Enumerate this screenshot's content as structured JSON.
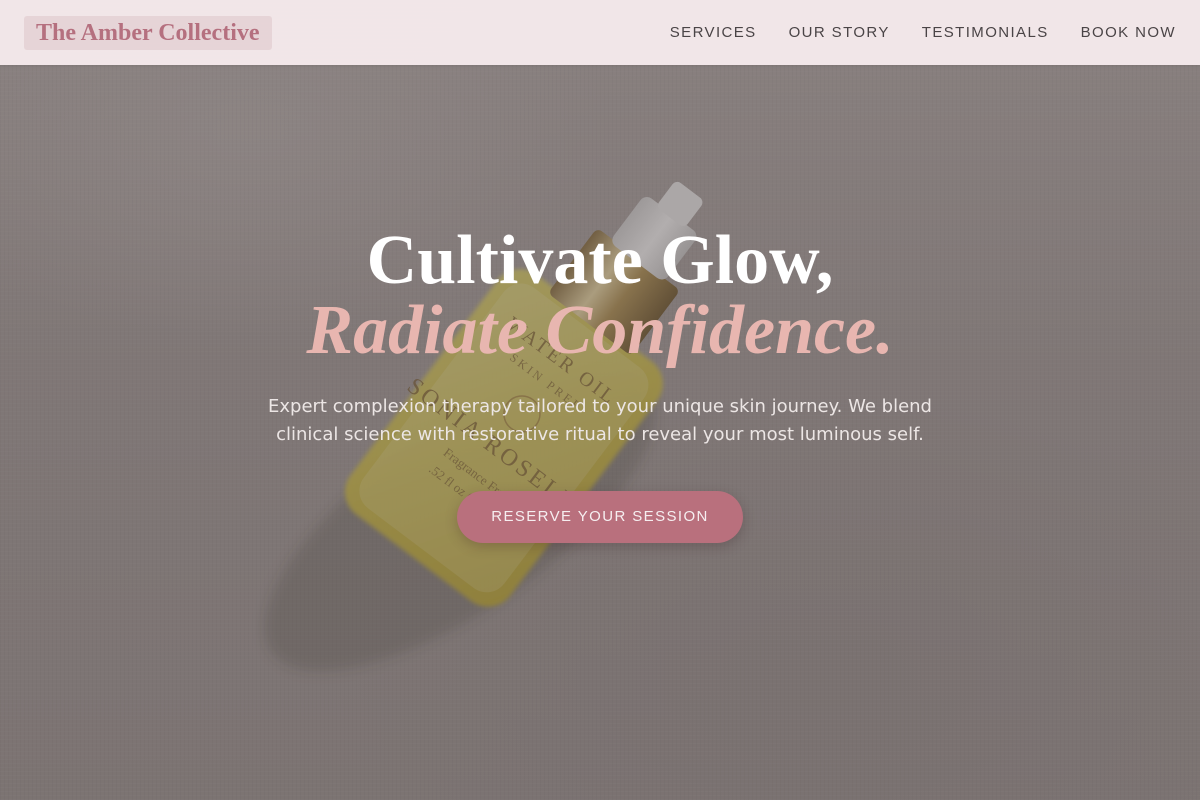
{
  "header": {
    "brand": "The Amber Collective",
    "nav": [
      {
        "label": "SERVICES"
      },
      {
        "label": "OUR STORY"
      },
      {
        "label": "TESTIMONIALS"
      },
      {
        "label": "BOOK NOW"
      }
    ]
  },
  "hero": {
    "headline_line1": "Cultivate Glow,",
    "headline_line2": "Radiate Confidence.",
    "subtext": "Expert complexion therapy tailored to your unique skin journey. We blend clinical science with restorative ritual to reveal your most luminous self.",
    "cta_label": "RESERVE YOUR SESSION",
    "background_image": {
      "label_text": [
        "WATER OIL",
        "SKIN PREP",
        "SONIA ROSELLI",
        "Fragrance Free",
        ".52 fl oz (15ml)"
      ]
    }
  },
  "colors": {
    "brand": "#b5707f",
    "accent_pink": "#e8b6b0",
    "cta_background": "#b9707d",
    "header_background": "#f6eaec"
  }
}
